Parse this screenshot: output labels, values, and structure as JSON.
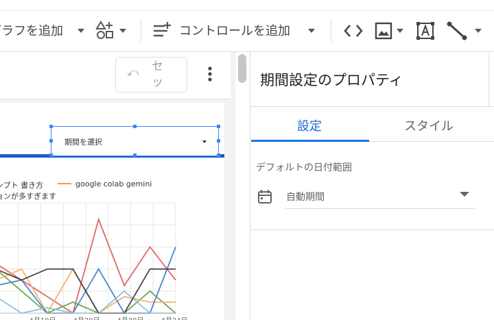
{
  "toolbar": {
    "add_chart_label": "グラフを追加",
    "add_control_label": "コントロールを追加"
  },
  "canvas": {
    "undo_label": "セ\nッ",
    "undo_glyph": "⤺"
  },
  "date_control": {
    "label": "期間を選択"
  },
  "chart_data": {
    "type": "line",
    "title": "",
    "xlabel": "",
    "ylabel": "",
    "legend": [
      {
        "name": "ンプト 書き方",
        "color": "#ffffff"
      },
      {
        "name": "google colab gemini",
        "color": "#f29b38"
      },
      {
        "name": "ョンが多すぎます",
        "color": "#ffffff"
      }
    ],
    "x_ticks": [
      "...",
      "4月10日",
      "4月20日",
      "4月30日",
      "4月24日"
    ],
    "ylim": [
      0,
      10
    ],
    "x": [
      0,
      1,
      2,
      3,
      4,
      5,
      6,
      7
    ],
    "series": [
      {
        "color": "#e06666",
        "values": [
          4.5,
          3,
          1.5,
          0,
          8.5,
          2.5,
          6,
          3
        ]
      },
      {
        "color": "#6aa84f",
        "values": [
          4,
          2,
          0,
          1,
          0,
          0,
          2,
          0
        ]
      },
      {
        "color": "#f6b26b",
        "values": [
          3,
          4,
          0,
          4,
          0,
          1.5,
          1,
          1
        ]
      },
      {
        "color": "#4a86c8",
        "values": [
          2.5,
          3,
          0,
          0,
          4,
          0,
          0,
          6
        ]
      },
      {
        "color": "#8fc1e0",
        "values": [
          1.5,
          0,
          0.5,
          0,
          0,
          2,
          0,
          0
        ]
      },
      {
        "color": "#434343",
        "values": [
          4,
          3,
          4,
          4,
          0,
          0,
          4,
          4
        ]
      }
    ]
  },
  "panel": {
    "title": "期間設定のプロパティ",
    "tabs": [
      {
        "label": "設定",
        "active": true
      },
      {
        "label": "スタイル",
        "active": false
      }
    ],
    "section_label": "デフォルトの日付範囲",
    "date_range_value": "自動期間"
  },
  "colors": {
    "accent": "#1a73e8",
    "tab_active": "#1967d2",
    "selection": "#4285f4"
  }
}
